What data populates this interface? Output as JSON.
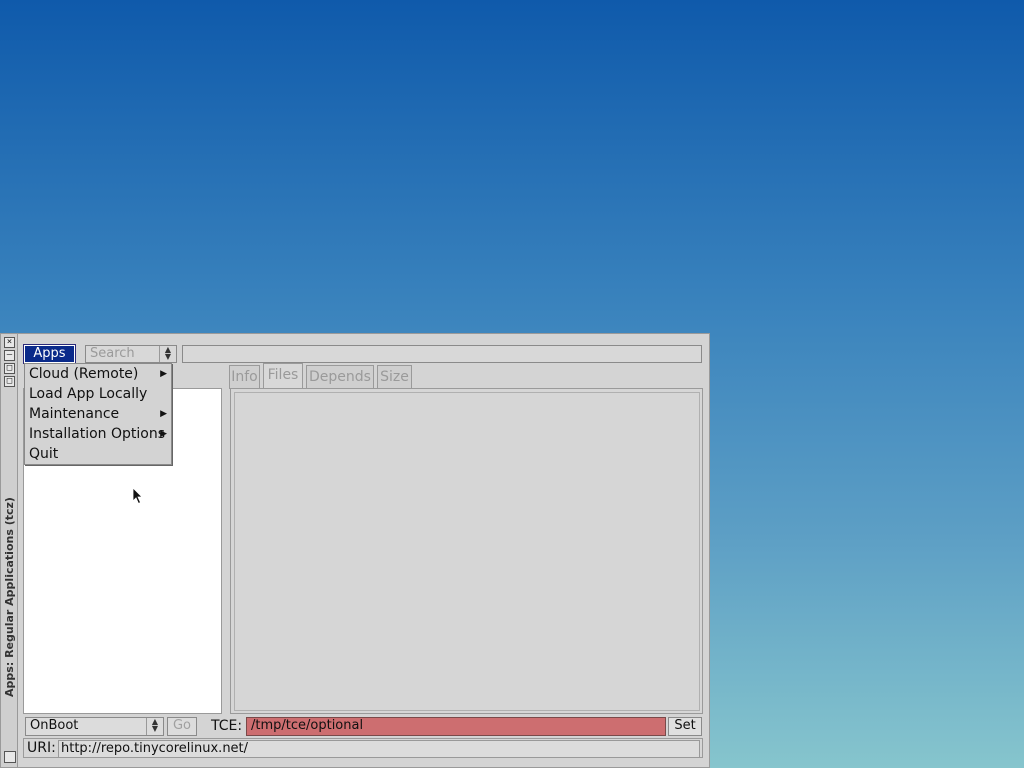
{
  "window": {
    "title": "Apps: Regular Applications (tcz)",
    "controls": [
      "×",
      "—",
      "□",
      "□"
    ]
  },
  "toolbar": {
    "apps_label": "Apps",
    "search_mode": "Search",
    "search_value": ""
  },
  "tabs": [
    {
      "label": "Info",
      "active": false
    },
    {
      "label": "Files",
      "active": true
    },
    {
      "label": "Depends",
      "active": false
    },
    {
      "label": "Size",
      "active": false
    }
  ],
  "bottom": {
    "install_mode": "OnBoot",
    "go_label": "Go",
    "tce_label": "TCE:",
    "tce_path": "/tmp/tce/optional",
    "set_label": "Set",
    "uri_label": "URI:",
    "uri_value": "http://repo.tinycorelinux.net/"
  },
  "menu": {
    "items": [
      {
        "label": "Cloud (Remote)",
        "submenu": true
      },
      {
        "label": "Load App Locally",
        "submenu": false
      },
      {
        "label": "Maintenance",
        "submenu": true
      },
      {
        "label": "Installation Options",
        "submenu": true
      },
      {
        "label": "Quit",
        "submenu": false
      }
    ]
  },
  "colors": {
    "desktop_top": "#0f5aab",
    "desktop_bottom": "#86c5cd",
    "apps_button": "#0a2a8a",
    "tce_field": "#cd6e70"
  }
}
